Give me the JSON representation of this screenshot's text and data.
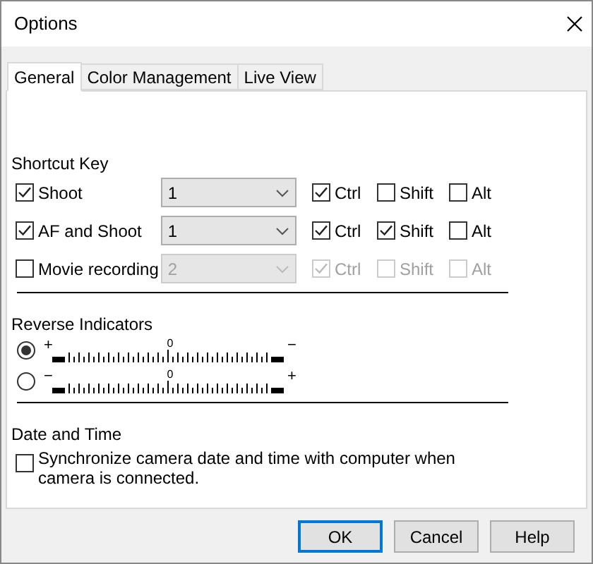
{
  "window": {
    "title": "Options"
  },
  "tabs": [
    {
      "label": "General",
      "selected": true
    },
    {
      "label": "Color Management",
      "selected": false
    },
    {
      "label": "Live View",
      "selected": false
    }
  ],
  "shortcut_key": {
    "heading": "Shortcut Key",
    "rows": [
      {
        "label": "Shoot",
        "checked": true,
        "disabled": false,
        "value": "1",
        "modifiers": [
          {
            "label": "Ctrl",
            "checked": true
          },
          {
            "label": "Shift",
            "checked": false
          },
          {
            "label": "Alt",
            "checked": false
          }
        ]
      },
      {
        "label": "AF and Shoot",
        "checked": true,
        "disabled": false,
        "value": "1",
        "modifiers": [
          {
            "label": "Ctrl",
            "checked": true
          },
          {
            "label": "Shift",
            "checked": true
          },
          {
            "label": "Alt",
            "checked": false
          }
        ]
      },
      {
        "label": "Movie recording",
        "checked": false,
        "disabled": true,
        "value": "2",
        "modifiers": [
          {
            "label": "Ctrl",
            "checked": true
          },
          {
            "label": "Shift",
            "checked": false
          },
          {
            "label": "Alt",
            "checked": false
          }
        ]
      }
    ]
  },
  "reverse_indicators": {
    "heading": "Reverse Indicators",
    "options": [
      {
        "selected": true,
        "left_sign": "+",
        "center": "0",
        "right_sign": "−"
      },
      {
        "selected": false,
        "left_sign": "−",
        "center": "0",
        "right_sign": "+"
      }
    ]
  },
  "date_and_time": {
    "heading": "Date and Time",
    "sync": {
      "label": "Synchronize camera date and time with computer when camera is connected.",
      "checked": false
    }
  },
  "buttons": [
    {
      "label": "OK",
      "default": true
    },
    {
      "label": "Cancel",
      "default": false
    },
    {
      "label": "Help",
      "default": false
    }
  ]
}
